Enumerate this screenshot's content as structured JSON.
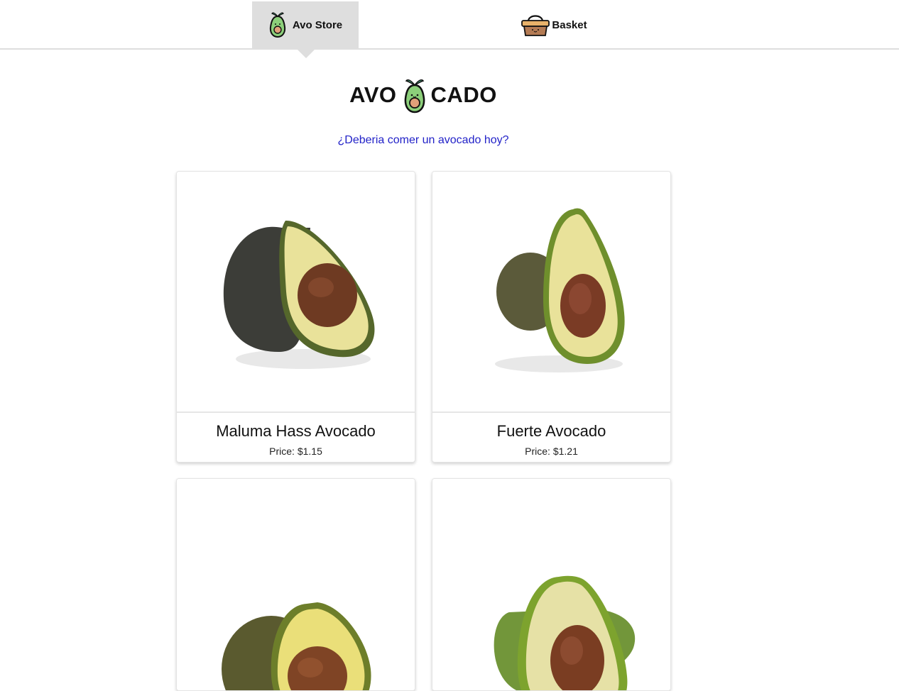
{
  "nav": {
    "store_label": "Avo Store",
    "basket_label": "Basket"
  },
  "hero": {
    "left": "AVO",
    "right": "CADO"
  },
  "tagline": "¿Deberia comer un avocado hoy?",
  "products": [
    {
      "name": "Maluma Hass Avocado",
      "price": "Price: $1.15"
    },
    {
      "name": "Fuerte Avocado",
      "price": "Price: $1.21"
    },
    {
      "name": "",
      "price": ""
    },
    {
      "name": "",
      "price": ""
    }
  ],
  "colors": {
    "active_tab": "#dedede",
    "link": "#2222c8",
    "avocado_skin_dark": "#3b3b38",
    "avocado_flesh": "#e9e29a",
    "avocado_pit": "#6e3a22"
  }
}
